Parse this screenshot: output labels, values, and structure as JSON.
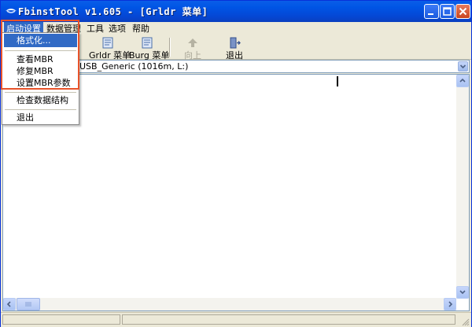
{
  "window": {
    "title": "FbinstTool v1.605 - [Grldr 菜单]"
  },
  "menubar": {
    "items": [
      "启动设置",
      "数据管理",
      "工具",
      "选项",
      "帮助"
    ]
  },
  "dropdown": {
    "items": [
      "格式化...",
      "查看MBR",
      "修复MBR",
      "设置MBR参数",
      "检查数据结构",
      "退出"
    ]
  },
  "toolbar": {
    "buttons": [
      "Grldr 菜单",
      "Burg 菜单",
      "向上",
      "退出"
    ]
  },
  "device": {
    "selected": "USB_Generic  (1016m, L:)"
  },
  "colors": {
    "title_bar": "#0055e5",
    "menu_highlight": "#316ac5",
    "annotation_outline": "#e8532a"
  }
}
